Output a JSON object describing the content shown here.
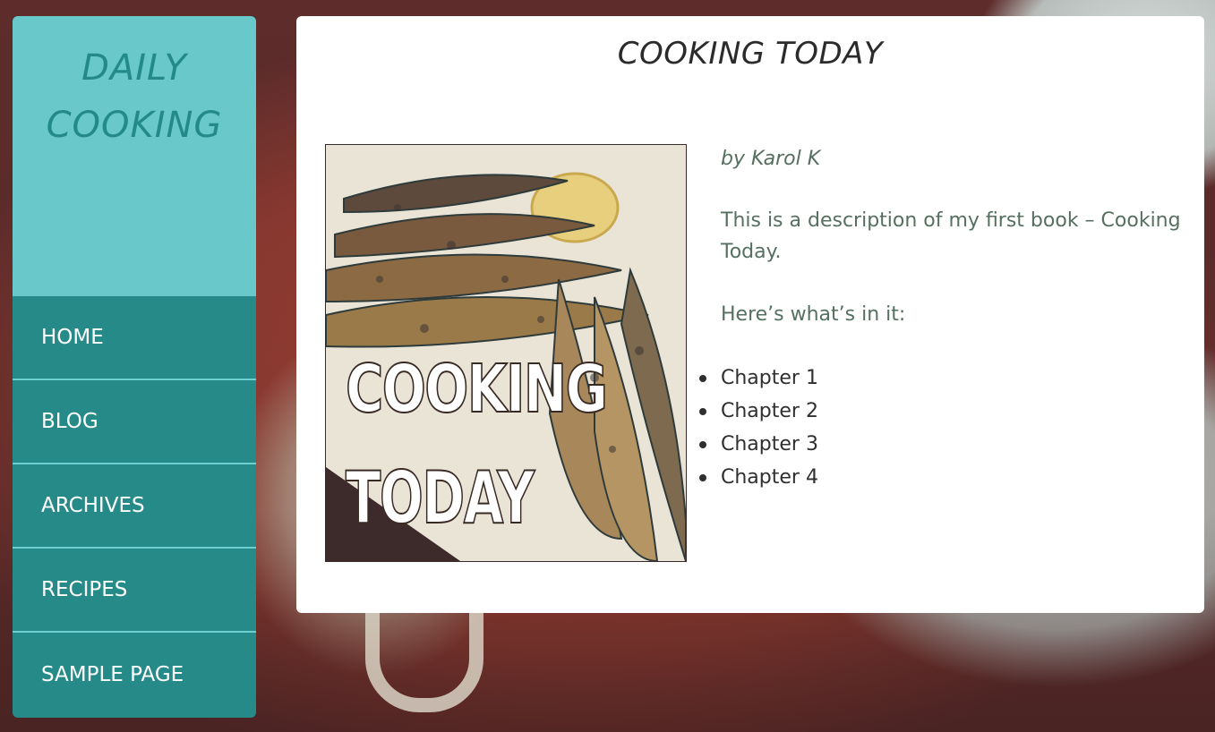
{
  "site": {
    "title_line1": "DAILY",
    "title_line2": "COOKING"
  },
  "nav": {
    "items": [
      {
        "label": "HOME"
      },
      {
        "label": "BLOG"
      },
      {
        "label": "ARCHIVES"
      },
      {
        "label": "RECIPES"
      },
      {
        "label": "SAMPLE PAGE"
      }
    ]
  },
  "page": {
    "title": "COOKING TODAY",
    "cover": {
      "line1": "COOKING",
      "line2": "TODAY"
    },
    "author": "by Karol K",
    "description": "This is a description of my first book – Cooking Today.",
    "contents_intro": "Here’s what’s in it:",
    "chapters": [
      "Chapter 1",
      "Chapter 2",
      "Chapter 3",
      "Chapter 4"
    ]
  },
  "colors": {
    "sidebar_header": "#68c8ca",
    "sidebar_nav": "#268a88",
    "title_text": "#238a88",
    "body_text": "#557060"
  }
}
